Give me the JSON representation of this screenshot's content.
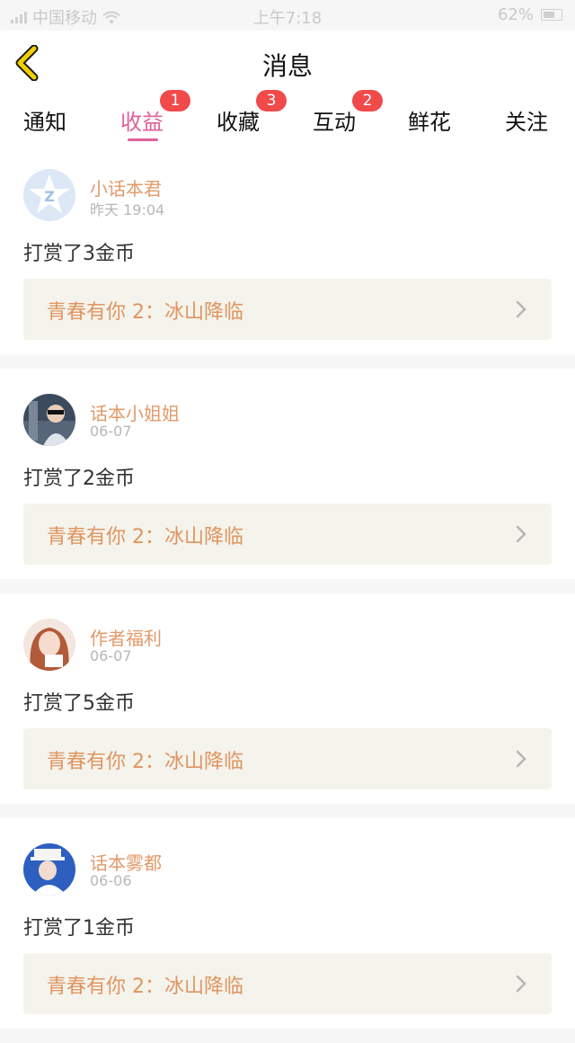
{
  "status_bar": {
    "carrier": "中国移动",
    "time": "上午7:18",
    "battery": "62%"
  },
  "header": {
    "title": "消息",
    "back_icon": "back-chevron-icon"
  },
  "tabs": [
    {
      "label": "通知",
      "badge": ""
    },
    {
      "label": "收益",
      "badge": "1",
      "active": true
    },
    {
      "label": "收藏",
      "badge": "3"
    },
    {
      "label": "互动",
      "badge": "2"
    },
    {
      "label": "鲜花",
      "badge": ""
    },
    {
      "label": "关注",
      "badge": ""
    }
  ],
  "messages": [
    {
      "name": "小话本君",
      "time": "昨天 19:04",
      "text": "打赏了3金币",
      "book": "青春有你 2：冰山降临"
    },
    {
      "name": "话本小姐姐",
      "time": "06-07",
      "text": "打赏了2金币",
      "book": "青春有你 2：冰山降临"
    },
    {
      "name": "作者福利",
      "time": "06-07",
      "text": "打赏了5金币",
      "book": "青春有你 2：冰山降临"
    },
    {
      "name": "话本雾都",
      "time": "06-06",
      "text": "打赏了1金币",
      "book": "青春有你 2：冰山降临"
    }
  ],
  "colors": {
    "accent": "#e0609a",
    "badge": "#f04a4a",
    "name": "#e29a6a",
    "book_title": "#e0955f",
    "back_arrow": "#f1d000"
  }
}
